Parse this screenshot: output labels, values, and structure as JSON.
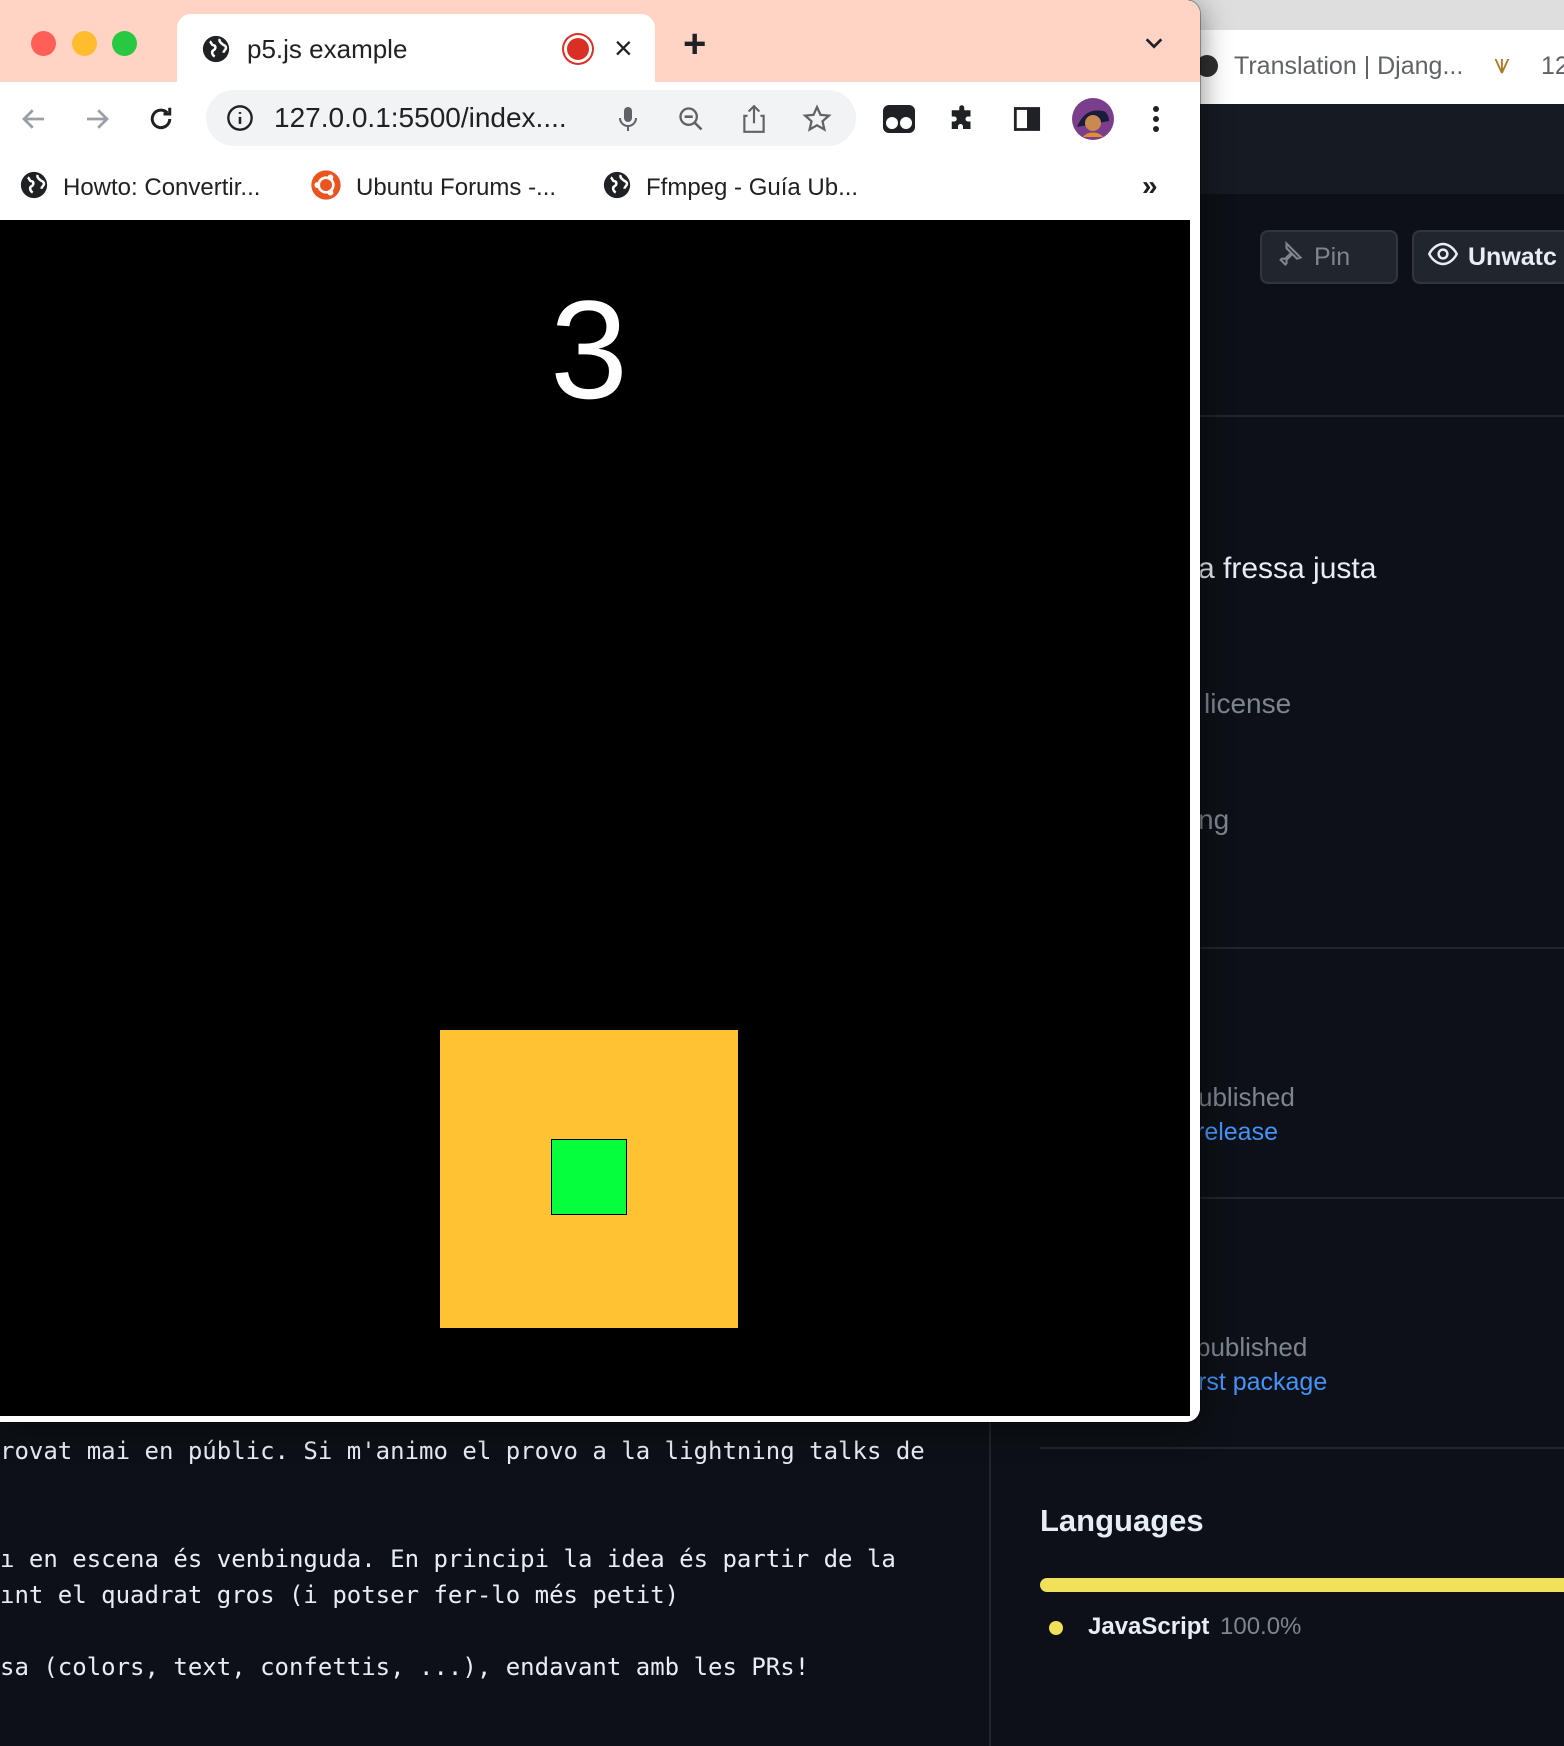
{
  "browser": {
    "tab_title": "p5.js example",
    "tab_close": "×",
    "new_tab": "+",
    "url": "127.0.0.1:5500/index....",
    "bookmarks": [
      {
        "label": "Howto: Convertir...",
        "icon": "globe-icon"
      },
      {
        "label": "Ubuntu Forums -...",
        "icon": "ubuntu-icon"
      },
      {
        "label": "Ffmpeg - Guía Ub...",
        "icon": "globe-icon"
      }
    ],
    "bookmarks_more": "»"
  },
  "game": {
    "countdown": "3",
    "background_color": "#000000",
    "big_square_color": "#ffc233",
    "small_square_color": "#05ff3c"
  },
  "background_window": {
    "tab_title": "Translation | Djang...",
    "tab2_partial": "12",
    "pin_label": "Pin",
    "unwatch_label": "Unwatc",
    "about_partial": "a fressa justa",
    "license_partial": "license",
    "ng_partial": "ng",
    "releases_partial": "ublished",
    "release_link_partial": "release",
    "packages_partial": "published",
    "package_link_partial": "rst package",
    "languages_heading": "Languages",
    "language_name": "JavaScript",
    "language_percent": "100.0%",
    "readme_lines": [
      "rovat mai en públic. Si m'animo el provo a la lightning talks de",
      "ı en escena és venbinguda. En principi la idea és partir de la",
      "ınt el quadrat gros (i potser fer-lo més petit)",
      "sa (colors, text, confettis, ...), endavant amb les PRs!"
    ]
  }
}
